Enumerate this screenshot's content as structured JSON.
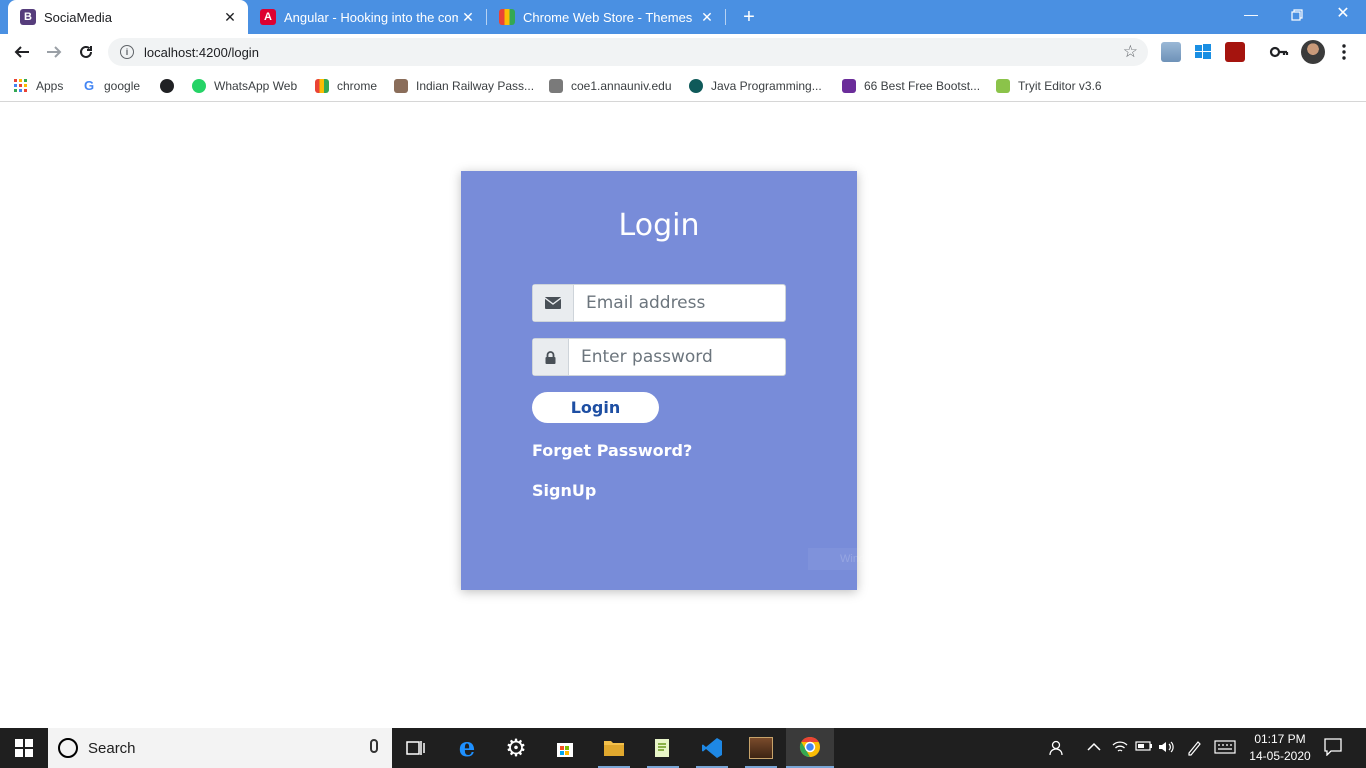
{
  "browser": {
    "tabs": [
      {
        "title": "SociaMedia",
        "favicon": "bootstrap-b-icon",
        "active": true
      },
      {
        "title": "Angular - Hooking into the comp",
        "favicon": "angular-icon",
        "active": false
      },
      {
        "title": "Chrome Web Store - Themes",
        "favicon": "chrome-web-store-icon",
        "active": false
      }
    ],
    "url": "localhost:4200/login",
    "bookmarks": [
      {
        "label": "Apps"
      },
      {
        "label": "google"
      },
      {
        "label": ""
      },
      {
        "label": "WhatsApp Web"
      },
      {
        "label": "chrome"
      },
      {
        "label": "Indian Railway Pass..."
      },
      {
        "label": "coe1.annauniv.edu"
      },
      {
        "label": "Java Programming..."
      },
      {
        "label": "66 Best Free Bootst..."
      },
      {
        "label": "Tryit Editor v3.6"
      }
    ]
  },
  "login": {
    "title": "Login",
    "email_placeholder": "Email address",
    "password_placeholder": "Enter password",
    "submit_label": "Login",
    "forgot_label": "Forget Password?",
    "signup_label": "SignUp"
  },
  "overlay": {
    "ghost_text": "Window Snip"
  },
  "taskbar": {
    "search_label": "Search",
    "time": "01:17 PM",
    "date": "14-05-2020"
  },
  "colors": {
    "tabstrip": "#4a90e2",
    "card": "#788cd9",
    "button_text": "#1e4fa3",
    "taskbar": "#1f1f1f"
  }
}
